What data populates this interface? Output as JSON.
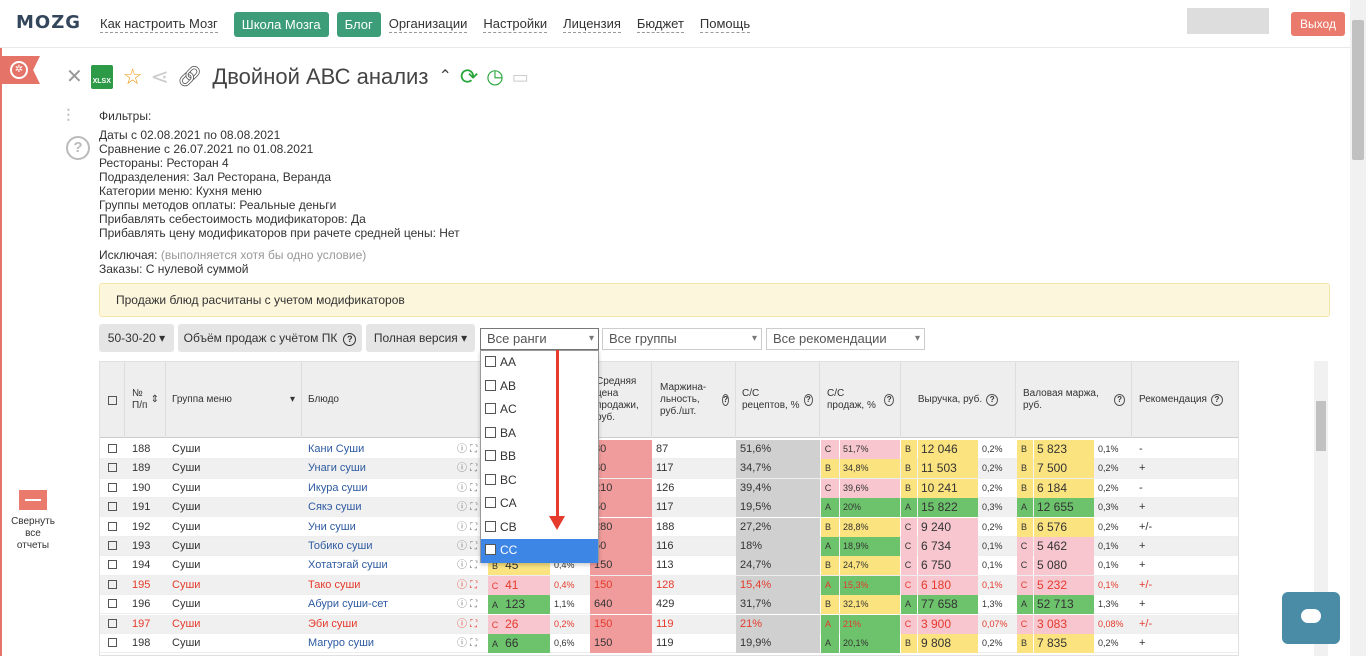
{
  "app": {
    "logo": "MOZG"
  },
  "nav": {
    "howto": "Как настроить Мозг",
    "school": "Школа Мозга",
    "blog": "Блог",
    "links": [
      "Организации",
      "Настройки",
      "Лицензия",
      "Бюджет",
      "Помощь"
    ],
    "logout": "Выход"
  },
  "side": {
    "collapse": "Свернуть все отчеты"
  },
  "report": {
    "title": "Двойной АВС анализ"
  },
  "filters": {
    "heading": "Фильтры:",
    "lines": [
      "Даты с 02.08.2021 по 08.08.2021",
      "Сравнение с 26.07.2021 по 01.08.2021",
      "Рестораны: Ресторан 4",
      "Подразделения: Зал Ресторана, Веранда",
      "Категории меню: Кухня меню",
      "Группы методов оплаты: Реальные деньги",
      "Прибавлять себестоимость модификаторов: Да",
      "Прибавлять цену модификаторов при рачете средней цены: Нет"
    ],
    "exclude_label": "Исключая:",
    "exclude_note": "(выполняется хотя бы одно условие)",
    "orders": "Заказы: С нулевой суммой"
  },
  "notice": "Продажи блюд расчитаны с учетом модификаторов",
  "controls": {
    "ratio": "50-30-20 ▾",
    "volume": "Объём продаж с учётом ПК",
    "version": "Полная версия ▾",
    "ranks_select": "Все ранги",
    "groups_select": "Все группы",
    "recs_select": "Все рекомендации"
  },
  "dropdown": {
    "options": [
      "AA",
      "AB",
      "AC",
      "BA",
      "BB",
      "BC",
      "CA",
      "CB",
      "CC"
    ],
    "highlighted": "CC"
  },
  "table": {
    "headers": {
      "num": "№ П/п",
      "group": "Группа меню",
      "dish": "Блюдо",
      "avg_price": "Средняя цена продажи, руб.",
      "margin": "Маржина- льность, руб./шт.",
      "cost_recipe": "С/С рецептов, %",
      "cost_sales": "С/С продаж, %",
      "revenue": "Выручка, руб.",
      "gross": "Валовая маржа, руб.",
      "rec": "Рекомендация"
    },
    "rows": [
      {
        "n": "188",
        "g": "Суши",
        "d": "Кани Суши",
        "qr": "",
        "qv": "",
        "qp": "",
        "price": "80",
        "m": "87",
        "cr": "51,6%",
        "csr": "C",
        "cs": "51,7%",
        "rr": "B",
        "rv": "12 046",
        "rp": "0,2%",
        "gr": "B",
        "gv": "5 823",
        "gp": "0,1%",
        "rec": "-",
        "red": false
      },
      {
        "n": "189",
        "g": "Суши",
        "d": "Унаги суши",
        "qr": "",
        "qv": "",
        "qp": "",
        "price": "80",
        "m": "117",
        "cr": "34,7%",
        "csr": "B",
        "cs": "34,8%",
        "rr": "B",
        "rv": "11 503",
        "rp": "0,2%",
        "gr": "B",
        "gv": "7 500",
        "gp": "0,2%",
        "rec": "+",
        "red": false
      },
      {
        "n": "190",
        "g": "Суши",
        "d": "Икура суши",
        "qr": "",
        "qv": "",
        "qp": "",
        "price": "210",
        "m": "126",
        "cr": "39,4%",
        "csr": "C",
        "cs": "39,6%",
        "rr": "B",
        "rv": "10 241",
        "rp": "0,2%",
        "gr": "B",
        "gv": "6 184",
        "gp": "0,2%",
        "rec": "-",
        "red": false
      },
      {
        "n": "191",
        "g": "Суши",
        "d": "Сякэ суши",
        "qr": "",
        "qv": "",
        "qp": "",
        "price": "50",
        "m": "117",
        "cr": "19,5%",
        "csr": "A",
        "cs": "20%",
        "rr": "A",
        "rv": "15 822",
        "rp": "0,3%",
        "gr": "A",
        "gv": "12 655",
        "gp": "0,3%",
        "rec": "+",
        "red": false
      },
      {
        "n": "192",
        "g": "Суши",
        "d": "Уни суши",
        "qr": "",
        "qv": "",
        "qp": "",
        "price": "280",
        "m": "188",
        "cr": "27,2%",
        "csr": "B",
        "cs": "28,8%",
        "rr": "C",
        "rv": "9 240",
        "rp": "0,2%",
        "gr": "B",
        "gv": "6 576",
        "gp": "0,2%",
        "rec": "+/-",
        "red": false
      },
      {
        "n": "193",
        "g": "Суши",
        "d": "Тобико суши",
        "qr": "",
        "qv": "",
        "qp": "",
        "price": "50",
        "m": "116",
        "cr": "18%",
        "csr": "A",
        "cs": "18,9%",
        "rr": "C",
        "rv": "6 734",
        "rp": "0,1%",
        "gr": "C",
        "gv": "5 462",
        "gp": "0,1%",
        "rec": "+",
        "red": false
      },
      {
        "n": "194",
        "g": "Суши",
        "d": "Хотатэгай суши",
        "qr": "B",
        "qv": "45",
        "qp": "0,4%",
        "price": "150",
        "m": "113",
        "cr": "24,7%",
        "csr": "B",
        "cs": "24,7%",
        "rr": "C",
        "rv": "6 750",
        "rp": "0,1%",
        "gr": "C",
        "gv": "5 080",
        "gp": "0,1%",
        "rec": "+",
        "red": false
      },
      {
        "n": "195",
        "g": "Суши",
        "d": "Тако суши",
        "qr": "C",
        "qv": "41",
        "qp": "0,4%",
        "price": "150",
        "m": "128",
        "cr": "15,4%",
        "csr": "A",
        "cs": "15,3%",
        "rr": "C",
        "rv": "6 180",
        "rp": "0,1%",
        "gr": "C",
        "gv": "5 232",
        "gp": "0,1%",
        "rec": "+/-",
        "red": true
      },
      {
        "n": "196",
        "g": "Суши",
        "d": "Абури суши-сет",
        "qr": "A",
        "qv": "123",
        "qp": "1,1%",
        "price": "640",
        "m": "429",
        "cr": "31,7%",
        "csr": "B",
        "cs": "32,1%",
        "rr": "A",
        "rv": "77 658",
        "rp": "1,3%",
        "gr": "A",
        "gv": "52 713",
        "gp": "1,3%",
        "rec": "+",
        "red": false
      },
      {
        "n": "197",
        "g": "Суши",
        "d": "Эби суши",
        "qr": "C",
        "qv": "26",
        "qp": "0,2%",
        "price": "150",
        "m": "119",
        "cr": "21%",
        "csr": "A",
        "cs": "21%",
        "rr": "C",
        "rv": "3 900",
        "rp": "0,07%",
        "gr": "C",
        "gv": "3 083",
        "gp": "0,08%",
        "rec": "+/-",
        "red": true
      },
      {
        "n": "198",
        "g": "Суши",
        "d": "Магуро суши",
        "qr": "A",
        "qv": "66",
        "qp": "0,6%",
        "price": "150",
        "m": "119",
        "cr": "19,9%",
        "csr": "A",
        "cs": "20,1%",
        "rr": "B",
        "rv": "9 808",
        "rp": "0,2%",
        "gr": "B",
        "gv": "7 835",
        "gp": "0,2%",
        "rec": "+",
        "red": false
      }
    ]
  },
  "rank_colors": {
    "A": "#6cc36c",
    "B": "#fbe37f",
    "C": "#f7c6cf"
  }
}
